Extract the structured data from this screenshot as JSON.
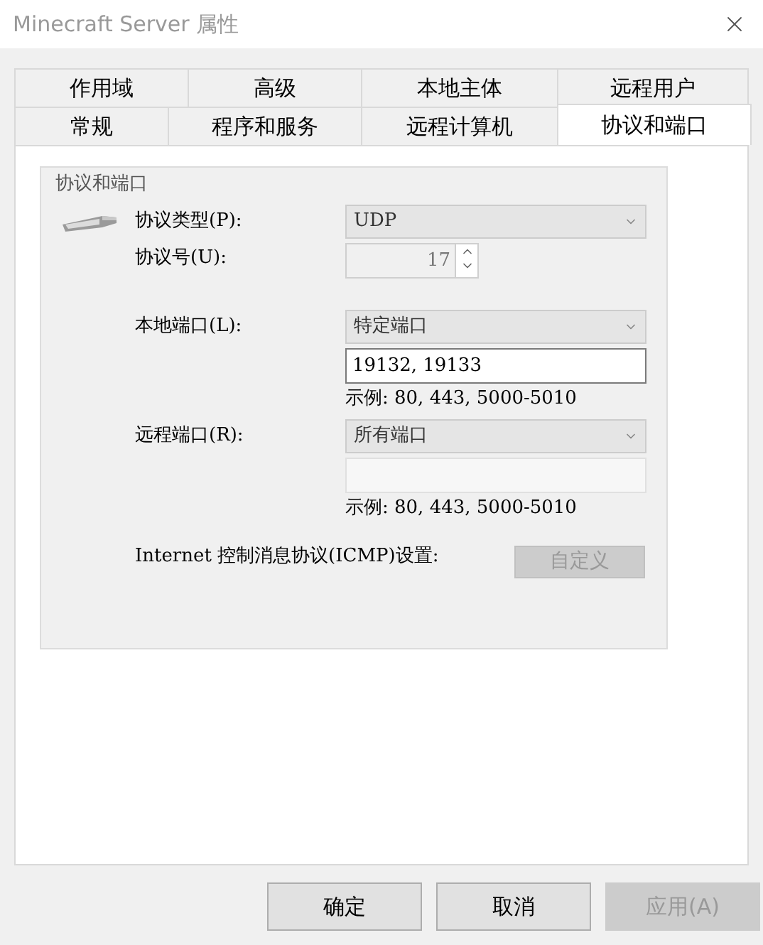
{
  "window": {
    "title": "Minecraft Server 属性"
  },
  "tab_rows": [
    [
      {
        "label": "作用域",
        "selected": false
      },
      {
        "label": "高级",
        "selected": false
      },
      {
        "label": "本地主体",
        "selected": false
      },
      {
        "label": "远程用户",
        "selected": false
      }
    ],
    [
      {
        "label": "常规",
        "selected": false
      },
      {
        "label": "程序和服务",
        "selected": false
      },
      {
        "label": "远程计算机",
        "selected": false
      },
      {
        "label": "协议和端口",
        "selected": true
      }
    ]
  ],
  "group": {
    "title": "协议和端口",
    "protocol_type": {
      "label": "协议类型(P):",
      "value": "UDP",
      "disabled": false
    },
    "protocol_number": {
      "label": "协议号(U):",
      "value": "17",
      "disabled": true
    },
    "local_port": {
      "label": "本地端口(L):",
      "value": "特定端口",
      "disabled": false,
      "ports": "19132, 19133",
      "ports_disabled": false,
      "example": "示例: 80, 443, 5000-5010"
    },
    "remote_port": {
      "label": "远程端口(R):",
      "value": "所有端口",
      "disabled": false,
      "ports_disabled": true,
      "example": "示例: 80, 443, 5000-5010"
    },
    "icmp": {
      "label": "Internet 控制消息协议(ICMP)设置:",
      "button": "自定义",
      "disabled": true
    }
  },
  "buttons": [
    {
      "label": "确定",
      "disabled": false
    },
    {
      "label": "取消",
      "disabled": false
    },
    {
      "label": "应用(A)",
      "disabled": true
    }
  ]
}
